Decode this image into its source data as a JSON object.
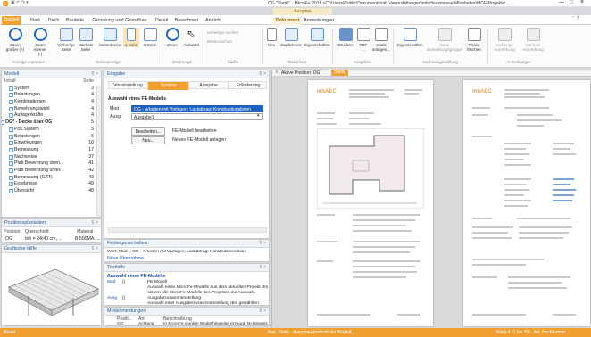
{
  "window": {
    "title": "OG \"Statik\" · MicroFe 2018  <C:\\Users\\Public\\Documents\\mb Veranstaltungen\\mb Hausmesse\\Mitarbeiter\\MGE\\Projekte\\...",
    "context_tab_group": "Ausgabe",
    "minimize": "—",
    "maximize": "□",
    "close": "×"
  },
  "tabs": [
    {
      "label": "Bauteil",
      "active": true
    },
    {
      "label": "Start"
    },
    {
      "label": "Dach"
    },
    {
      "label": "Bauteile"
    },
    {
      "label": "Gründung und Grundbau"
    },
    {
      "label": "Detail"
    },
    {
      "label": "Berechnen"
    },
    {
      "label": "Ansicht"
    },
    {
      "label": "Dokument",
      "ctx": true
    },
    {
      "label": "Anmerkungen"
    }
  ],
  "ribbon": {
    "buttons": [
      {
        "label": "Zoom\ngrößer (+)"
      },
      {
        "label": "Zoom kleiner\n(-)"
      },
      {
        "label": "Vorherige\nSeite"
      },
      {
        "label": "Nächste\nSeite"
      },
      {
        "label": "Seitenbreite"
      },
      {
        "label": "1 Seite"
      },
      {
        "label": "2 Seite"
      },
      {
        "label": "Zoom"
      },
      {
        "label": "Auswahl"
      },
      {
        "label": "Neu"
      },
      {
        "label": "Duplizieren"
      },
      {
        "label": "Eigenschaften"
      },
      {
        "label": "Drucken"
      },
      {
        "label": "PDF\n..."
      },
      {
        "label": "Statik\nanlegen..."
      },
      {
        "label": "Eigenschaften"
      },
      {
        "label": "Neue\nBemerkungsgruppe"
      },
      {
        "label": "Phase\nlöschen"
      },
      {
        "label": "Vorherige\nAnmerkung"
      },
      {
        "label": "Nächste\nAnmerkung"
      }
    ],
    "small_items": [
      "vorherige suchen",
      "Weitersuchen"
    ],
    "groups": [
      "Anzeige anpassen",
      "Seitenanzeige",
      "Werkzeuge",
      "Suche",
      "Dokument",
      "Ausgaben",
      "Nachweisgestaltung",
      "Anmerkungen"
    ]
  },
  "model_panel": {
    "title": "Modell",
    "col_inhalt": "Inhalt",
    "col_seite": "Seite",
    "items": [
      {
        "label": "System",
        "page": "3"
      },
      {
        "label": "Belastungen",
        "page": "4"
      },
      {
        "label": "Kombinationen",
        "page": "4"
      },
      {
        "label": "Bewehrungswahl",
        "page": "4"
      },
      {
        "label": "Auflagerkräfte",
        "page": "4"
      },
      {
        "label": "OG* - Decke über OG",
        "page": "5"
      },
      {
        "label": "Pos.System",
        "page": "5"
      },
      {
        "label": "Belastungen",
        "page": "6"
      },
      {
        "label": "Einwirkungen",
        "page": "10"
      },
      {
        "label": "Bemessung",
        "page": "17"
      },
      {
        "label": "Nachweise",
        "page": "37"
      },
      {
        "label": "Platt Bewehrung oben...",
        "page": "41"
      },
      {
        "label": "Platt Bewehrung unter...",
        "page": "42"
      },
      {
        "label": "Bemessung (GZT)",
        "page": "43"
      },
      {
        "label": "Ergebnisse",
        "page": "49"
      },
      {
        "label": "Übersicht",
        "page": "48"
      }
    ]
  },
  "positions_panel": {
    "title": "Positionsplanladen",
    "headers": [
      "Position",
      "Querschnitt",
      "Material"
    ],
    "row": [
      "OG",
      "b/h = 24/40 cm, ...",
      "B 500MA, ..."
    ]
  },
  "grafik_panel": {
    "title": "Grafische Hilfe"
  },
  "eingabe_panel": {
    "title": "Eingabe",
    "tabs": [
      "Voreinstellung",
      "System",
      "Ausgabe",
      "Erläuterung"
    ],
    "section_title": "Auswahl eines FE-Modells",
    "mod_label": "Mod",
    "mod_value": "OG - Arbeiten mit Vorlagen; Lastabtrag; Konstruktionslinien",
    "ausg_label": "Ausg",
    "ausg_value": "Ausgabe1",
    "btn_edit": "Bearbeiten...",
    "btn_new": "Neu...",
    "desc_edit": "FE-Modell bearbeiten",
    "desc_new": "Neues FE-Modell anlegen"
  },
  "feldeigenschaften": {
    "title": "Feldeigenschaften",
    "line1": "Wert: Mod = OG - Arbeiten mit Vorlagen; Lastabtrag; Konstruktionslinien",
    "link": "Neue Übernahme"
  },
  "texthilfe": {
    "title": "Texthilfe",
    "heading": "Auswahl eines FE-Modells",
    "rows": [
      {
        "k": "Mod",
        "s": "{}",
        "v": "FE-Modell"
      },
      {
        "k": "",
        "s": "",
        "v": "Auswahl eines MicroFe-Modells aus dem aktuellen Projekt. Es"
      },
      {
        "k": "",
        "s": "",
        "v": "stehen alle MicroFe-Modelle des Projektes zur Auswahl."
      },
      {
        "k": "Ausg",
        "s": "{}",
        "v": "Ausgabezusammenstellung"
      },
      {
        "k": "",
        "s": "",
        "v": "Auswahl einer Ausgabezusammenstellung des gewählten"
      }
    ]
  },
  "modellmeldungen": {
    "title": "Modellmeldungen",
    "headers": [
      "Positi...",
      "Art",
      "Beschreibung"
    ],
    "rows": [
      [
        "OG",
        "Achtung",
        "In MicroFe wurden Modellhinweise erzeugt. Nr.Hinweis"
      ],
      [
        "OG",
        "Hinweis",
        "Die Mindestdicke einer Vollplatte aus Ortbeton mit"
      ],
      [
        "OG",
        "Hinweis",
        "..."
      ]
    ]
  },
  "preview": {
    "tab_label": "Aktive Position: OG",
    "badge": "Statik",
    "logo_a": "mb",
    "logo_b": "AEC"
  },
  "status": {
    "left": "Bereit",
    "center": "Pos. Statik · Ausgabeabschnitt der Bauteil...",
    "right": "Seite 4 (1 bis 79) · A4, Hochformat"
  },
  "colors": {
    "accent": "#f0a030",
    "link_blue": "#1f4fa8",
    "panel_header": "#2f5d8a"
  }
}
